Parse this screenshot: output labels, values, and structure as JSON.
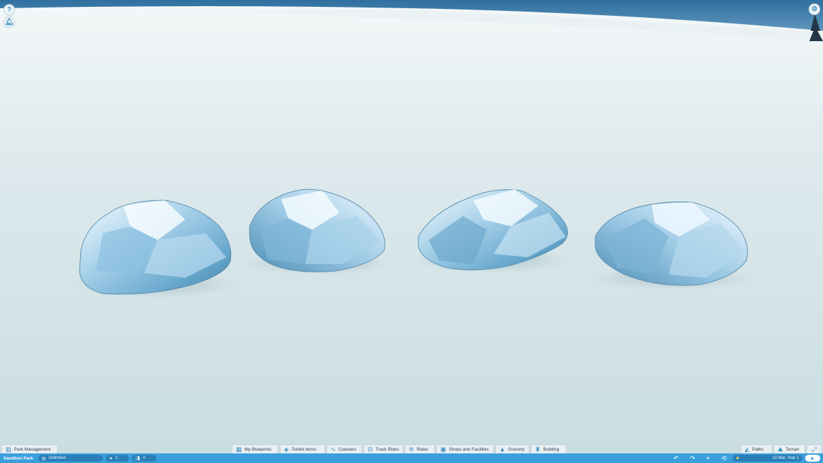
{
  "top_buttons": {
    "help": "?"
  },
  "bottom_left": {
    "park_management": "Park Management"
  },
  "toolbar": {
    "tabs": [
      {
        "label": "My Blueprints",
        "icon": "blueprint-icon",
        "glyph": "▦"
      },
      {
        "label": "Toolkit Items",
        "icon": "cube-icon",
        "glyph": "◈"
      },
      {
        "label": "Coasters",
        "icon": "coaster-icon",
        "glyph": "∿"
      },
      {
        "label": "Track Rides",
        "icon": "track-ride-icon",
        "glyph": "⊟"
      },
      {
        "label": "Rides",
        "icon": "ferris-wheel-icon",
        "glyph": "✲"
      },
      {
        "label": "Shops and Facilities",
        "icon": "shop-icon",
        "glyph": "▣"
      },
      {
        "label": "Scenery",
        "icon": "tree-icon",
        "glyph": "▲"
      },
      {
        "label": "Building",
        "icon": "castle-icon",
        "glyph": "♜"
      }
    ],
    "right_tabs": [
      {
        "label": "Paths",
        "icon": "path-icon",
        "glyph": "◭"
      },
      {
        "label": "Terrain",
        "icon": "terrain-icon",
        "glyph": "⛰"
      }
    ]
  },
  "status": {
    "park_name": "Sandbox Park",
    "money": "Unlimited",
    "rating": "2",
    "guests": "0",
    "date": "10 Mar, Year 1"
  },
  "colors": {
    "status_bar": "#3a9fdd",
    "accent": "#3d8fc4",
    "snow": "#d6e6ea"
  }
}
